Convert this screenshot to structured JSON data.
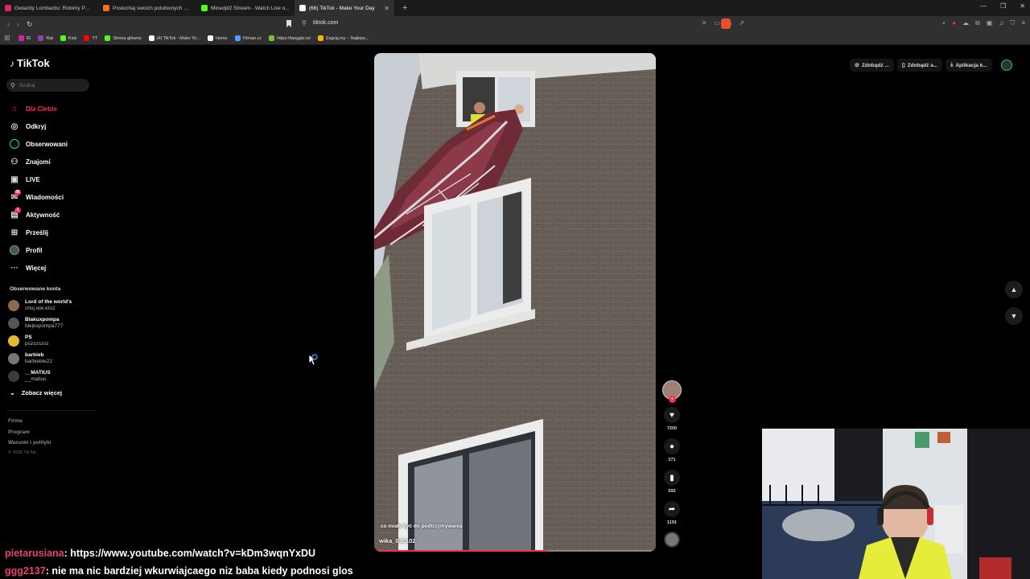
{
  "browser": {
    "tabs": [
      {
        "title": "Gwiazdy Lombardu: Robimy PRAWC...",
        "color": "#e0245e",
        "active": false
      },
      {
        "title": "Posłuchaj swoich polubionych utwo...",
        "color": "#f46f1d",
        "active": false
      },
      {
        "title": "Minedpl2 Stream - Watch Live o...",
        "color": "#53fc18",
        "active": false
      },
      {
        "title": "(66) TikTok - Make Your Day",
        "color": "#ffffff",
        "active": true
      }
    ],
    "new_tab": "+",
    "url": "tiktok.com",
    "bookmarks": [
      {
        "label": "IG",
        "color": "#d6249f"
      },
      {
        "label": "Rat",
        "color": "#8e44ad"
      },
      {
        "label": "Kick",
        "color": "#53fc18"
      },
      {
        "label": "YT",
        "color": "#ff0000"
      },
      {
        "label": "Strona główna",
        "color": "#53fc18"
      },
      {
        "label": "(4) TikTok - Make Yo...",
        "color": "#ffffff"
      },
      {
        "label": "Home",
        "color": "#ffffff"
      },
      {
        "label": "Filman.cc",
        "color": "#4aa3ff"
      },
      {
        "label": "https://tanggle.io/",
        "color": "#7dbf3a"
      },
      {
        "label": "Zagraj.my – Najleps...",
        "color": "#f4b400"
      }
    ]
  },
  "tiktok": {
    "logo": "TikTok",
    "search_placeholder": "Szukaj",
    "nav": [
      {
        "label": "Dla Ciebie",
        "icon": "home-icon",
        "glyph": "⌂",
        "active": true
      },
      {
        "label": "Odkryj",
        "icon": "compass-icon",
        "glyph": "◎"
      },
      {
        "label": "Obserwowani",
        "icon": "following-icon",
        "glyph": "ring"
      },
      {
        "label": "Znajomi",
        "icon": "friends-icon",
        "glyph": "⚇"
      },
      {
        "label": "LIVE",
        "icon": "live-icon",
        "glyph": "▣"
      },
      {
        "label": "Wiadomości",
        "icon": "messages-icon",
        "glyph": "✉",
        "badge": "66"
      },
      {
        "label": "Aktywność",
        "icon": "activity-icon",
        "glyph": "▤",
        "badge": "1"
      },
      {
        "label": "Prześlij",
        "icon": "upload-icon",
        "glyph": "⊞"
      },
      {
        "label": "Profil",
        "icon": "profile-icon",
        "glyph": "avatar"
      },
      {
        "label": "Więcej",
        "icon": "more-icon",
        "glyph": "···"
      }
    ],
    "following_title": "Obserwowane konta",
    "following": [
      {
        "name": "Lord of the world's",
        "handle": "chuj.wie.kto2",
        "color": "#8a6b4e"
      },
      {
        "name": "Blakuxpompa",
        "handle": "blejkxpompa777",
        "color": "#555"
      },
      {
        "name": "PS",
        "handle": "pszszszsz",
        "color": "#e8b830"
      },
      {
        "name": "barbieb",
        "handle": "barbiebie22",
        "color": "#777"
      },
      {
        "name": "__MATIUS",
        "handle": "__matius",
        "color": "#3a3a3a"
      }
    ],
    "see_more": "Zobacz więcej",
    "footer": [
      "Firma",
      "Program",
      "Warunki i polityki"
    ],
    "copyright": "© 2026 TikTok",
    "header_buttons": [
      {
        "label": "Zdobądź ...",
        "glyph": "⊘"
      },
      {
        "label": "Zdobądź a...",
        "glyph": "▯"
      },
      {
        "label": "Aplikacja k...",
        "glyph": "⤓"
      }
    ],
    "video": {
      "caption": "co miały być do podtrzymywania",
      "author": "wika_030102",
      "progress": 0.62
    },
    "actions": {
      "likes": "7200",
      "comments": "371",
      "saves": "592",
      "shares": "1191"
    }
  },
  "stream_chat": [
    {
      "user": "pietarusiana",
      "message": ": https://www.youtube.com/watch?v=kDm3wqnYxDU"
    },
    {
      "user": "ggg2137",
      "message": ": nie ma nic bardziej wkurwiajcaego niz baba kiedy podnosi glos"
    }
  ]
}
